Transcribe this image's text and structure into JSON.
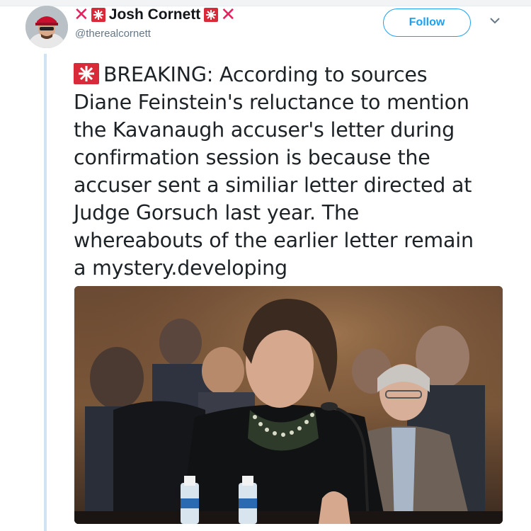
{
  "tweet": {
    "display_name": "Josh Cornett",
    "handle": "@therealcornett",
    "follow_label": "Follow",
    "text_lines": [
      "BREAKING: According to sources",
      "Diane Feinstein's reluctance to mention",
      "the Kavanaugh accuser's letter during",
      "confirmation session is because the",
      "accuser sent a similiar letter directed at",
      "Judge Gorsuch last year. The",
      "whereabouts of the earlier letter remain",
      "a mystery.developing"
    ],
    "name_decor_icons": [
      "cross-mark-icon",
      "siren-emoji-icon",
      "siren-emoji-icon",
      "cross-mark-icon"
    ]
  },
  "colors": {
    "follow_blue": "#1da1f2",
    "handle_gray": "#657786",
    "cross_red": "#e0245e",
    "siren_red": "#d92a3a",
    "thread_line": "#cfe3f5"
  }
}
